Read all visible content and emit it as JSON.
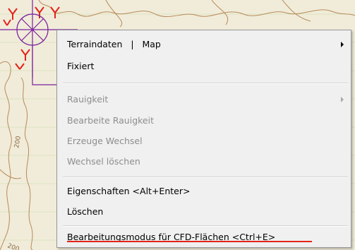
{
  "context_menu": {
    "terrain_item": {
      "left": "Terraindaten",
      "separator": "|",
      "right": "Map"
    },
    "fixed": "Fixiert",
    "roughness": "Rauigkeit",
    "edit_roughness": "Bearbeite Rauigkeit",
    "create_switch": "Erzeuge Wechsel",
    "delete_switch": "Wechsel löschen",
    "properties": "Eigenschaften <Alt+Enter>",
    "delete": "Löschen",
    "cfd_edit_mode": "Bearbeitungsmodus für CFD-Flächen <Ctrl+E>"
  },
  "map": {
    "contour_label_1": "200",
    "contour_label_2": "200"
  },
  "colors": {
    "highlight_underline": "#e2231a",
    "map_boundary": "#7a1f9e",
    "map_marker": "#e2231a",
    "map_background": "#f1ecd9"
  }
}
